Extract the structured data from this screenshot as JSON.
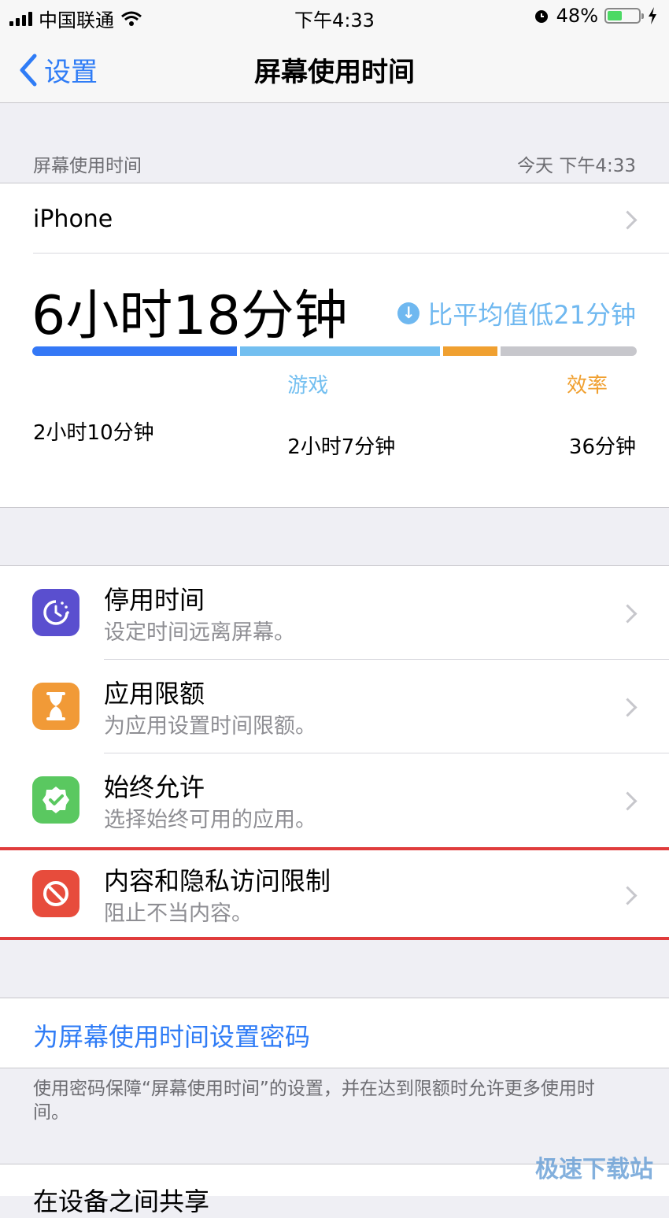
{
  "status_bar": {
    "carrier": "中国联通",
    "time": "下午4:33",
    "battery_percent": "48%",
    "battery_level": 0.48
  },
  "nav": {
    "back_label": "设置",
    "title": "屏幕使用时间"
  },
  "section": {
    "header_left": "屏幕使用时间",
    "header_right": "今天 下午4:33"
  },
  "usage": {
    "device": "iPhone",
    "total": "6小时18分钟",
    "compare": "比平均值低21分钟",
    "categories": [
      {
        "label": "",
        "duration": "2小时10分钟",
        "color": "#3478f6",
        "share": 0.344
      },
      {
        "label": "游戏",
        "duration": "2小时7分钟",
        "color": "#73bff0",
        "share": 0.336
      },
      {
        "label": "效率",
        "duration": "36分钟",
        "color": "#f0a030",
        "share": 0.095
      },
      {
        "label": "",
        "duration": "",
        "color": "#c7c7cc",
        "share": 0.225
      }
    ]
  },
  "menu": {
    "items": [
      {
        "title": "停用时间",
        "subtitle": "设定时间远离屏幕。",
        "icon": "downtime-icon",
        "color": "#5a4fcf"
      },
      {
        "title": "应用限额",
        "subtitle": "为应用设置时间限额。",
        "icon": "hourglass-icon",
        "color": "#f19a37"
      },
      {
        "title": "始终允许",
        "subtitle": "选择始终可用的应用。",
        "icon": "checkmark-badge-icon",
        "color": "#5ac860"
      },
      {
        "title": "内容和隐私访问限制",
        "subtitle": "阻止不当内容。",
        "icon": "restriction-icon",
        "color": "#e74c3c"
      }
    ]
  },
  "passcode": {
    "link": "为屏幕使用时间设置密码",
    "footer": "使用密码保障“屏幕使用时间”的设置，并在达到限额时允许更多使用时间。"
  },
  "bottom_partial": "在设备之间共享",
  "watermark": "极速下载站"
}
